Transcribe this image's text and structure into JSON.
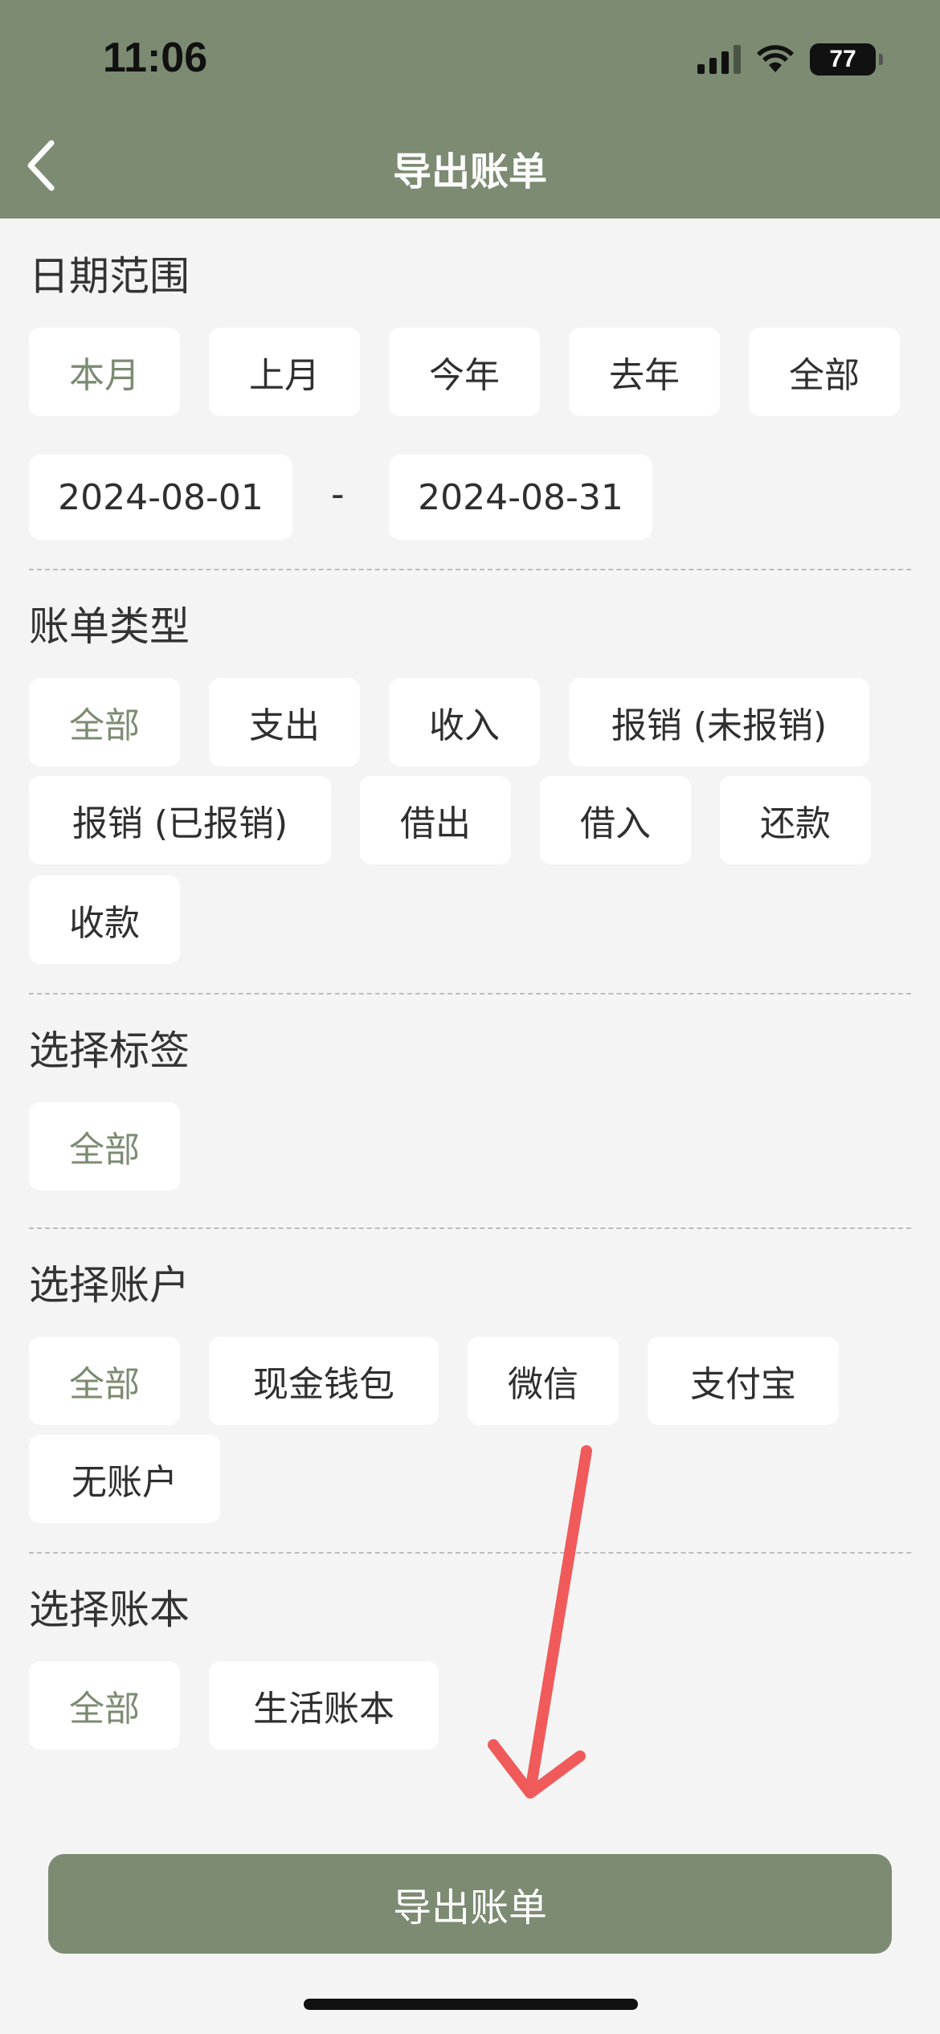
{
  "theme": {
    "accent": "#7c8b72",
    "annotation_arrow": "#f05a5a"
  },
  "status_bar": {
    "time": "11:06",
    "battery": "77"
  },
  "nav": {
    "title": "导出账单",
    "back_icon": "chevron-left-icon"
  },
  "date_range": {
    "title": "日期范围",
    "presets": [
      "本月",
      "上月",
      "今年",
      "去年",
      "全部"
    ],
    "selected_preset": "本月",
    "start": "2024-08-01",
    "separator": "-",
    "end": "2024-08-31"
  },
  "bill_type": {
    "title": "账单类型",
    "options": [
      "全部",
      "支出",
      "收入",
      "报销 (未报销)",
      "报销 (已报销)",
      "借出",
      "借入",
      "还款",
      "收款"
    ],
    "selected": "全部"
  },
  "tags": {
    "title": "选择标签",
    "options": [
      "全部"
    ],
    "selected": "全部"
  },
  "accounts": {
    "title": "选择账户",
    "options": [
      "全部",
      "现金钱包",
      "微信",
      "支付宝",
      "无账户"
    ],
    "selected": "全部"
  },
  "ledgers": {
    "title": "选择账本",
    "options": [
      "全部",
      "生活账本"
    ],
    "selected": "全部"
  },
  "export_button": {
    "label": "导出账单"
  }
}
